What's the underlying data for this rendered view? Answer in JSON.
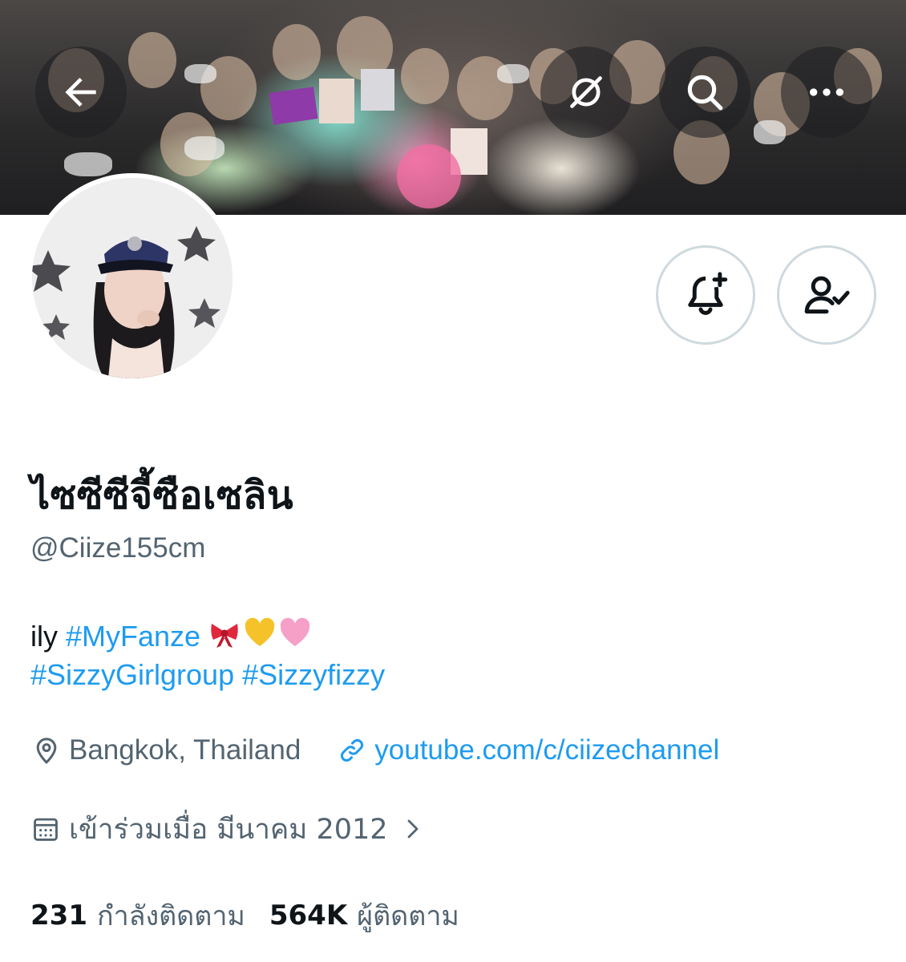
{
  "header": {
    "back_icon": "arrow-left-icon",
    "grok_icon": "slash-circle-icon",
    "search_icon": "search-icon",
    "more_icon": "more-dots-icon"
  },
  "profile": {
    "display_name": "ไซซีซีจี้ซือเซลิน",
    "handle": "@Ciize155cm",
    "bio_prefix": "ily",
    "bio_tag1": "#MyFanze",
    "bio_emojis": [
      "ribbon",
      "yellow-heart",
      "pink-heart"
    ],
    "bio_tag2": "#SizzyGirlgroup",
    "bio_tag3": "#Sizzyfizzy",
    "location": "Bangkok, Thailand",
    "website": "youtube.com/c/ciizechannel",
    "joined": "เข้าร่วมเมื่อ มีนาคม 2012",
    "following_count": "231",
    "following_label": "กำลังติดตาม",
    "followers_count": "564K",
    "followers_label": "ผู้ติดตาม"
  },
  "colors": {
    "accent": "#1d9bf0",
    "secondary_text": "#536471",
    "primary_text": "#0f1419",
    "border": "#cfd9de"
  }
}
